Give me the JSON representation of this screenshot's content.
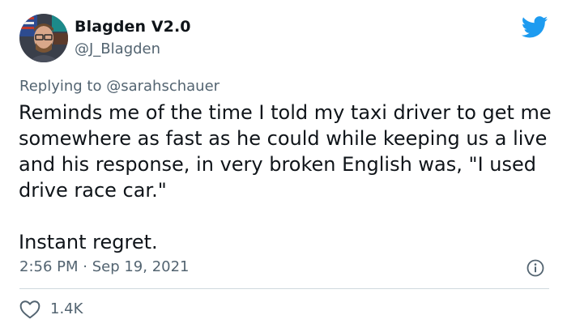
{
  "user": {
    "display_name": "Blagden V2.0",
    "handle": "@J_Blagden"
  },
  "reply": {
    "prefix": "Replying to ",
    "mention": "@sarahschauer"
  },
  "tweet": {
    "paragraphs": [
      "Reminds me of the time I told my taxi driver to get me somewhere as fast as he could while keeping us a live and his response, in very broken English was, \"I used drive race car.\"",
      "Instant regret."
    ],
    "timestamp": "2:56 PM · Sep 19, 2021"
  },
  "engagement": {
    "likes": "1.4K"
  },
  "icons": {
    "brand": "twitter-bird-icon",
    "info": "info-icon",
    "like": "heart-icon"
  },
  "colors": {
    "brand_blue": "#1d9bf0",
    "text_primary": "#0f1419",
    "text_secondary": "#536471",
    "divider": "#cfd9de"
  }
}
